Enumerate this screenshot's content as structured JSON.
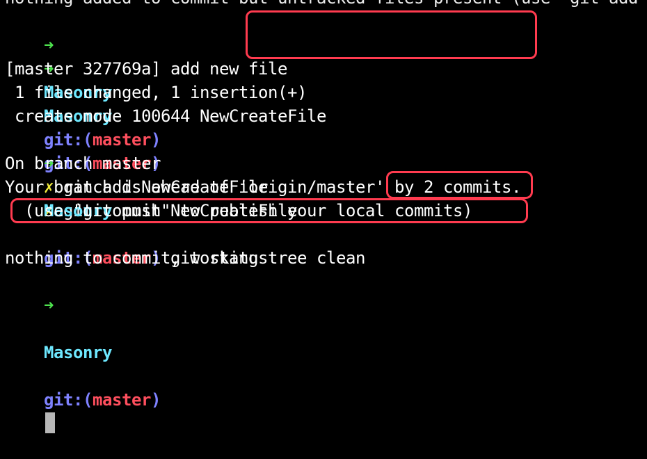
{
  "terminal": {
    "cropped_top_text": "nothing added to commit but untracked files present (use \"git add",
    "prompt": {
      "arrow": "➜",
      "directory": "Masonry",
      "git_prefix": "git:(",
      "branch": "master",
      "git_suffix": ")",
      "dirty_marker": "✗"
    },
    "lines": [
      {
        "type": "prompt",
        "command": " git add NewCreateFile"
      },
      {
        "type": "prompt",
        "command": " git commit NewCreateFile"
      },
      {
        "type": "output",
        "text": "[master 327769a] add new file"
      },
      {
        "type": "output",
        "text": " 1 file changed, 1 insertion(+)"
      },
      {
        "type": "output",
        "text": " create mode 100644 NewCreateFile"
      },
      {
        "type": "prompt",
        "command": " git status"
      },
      {
        "type": "output",
        "text": "On branch master"
      },
      {
        "type": "output",
        "text": "Your branch is ahead of 'origin/master' by 2 commits."
      },
      {
        "type": "output",
        "text": "  (use \"git push\" to publish your local commits)"
      },
      {
        "type": "output",
        "text": "nothing to commit, working tree clean"
      },
      {
        "type": "prompt",
        "command": ""
      }
    ]
  },
  "colors": {
    "background": "#000000",
    "text": "#ffffff",
    "arrow": "#4ee34e",
    "directory": "#6ee8ff",
    "git_label": "#7f82ff",
    "branch": "#ff4f5e",
    "dirty_marker": "#f1eb3b",
    "highlight": "#ff3b4f",
    "cursor": "#b7b7b7"
  }
}
